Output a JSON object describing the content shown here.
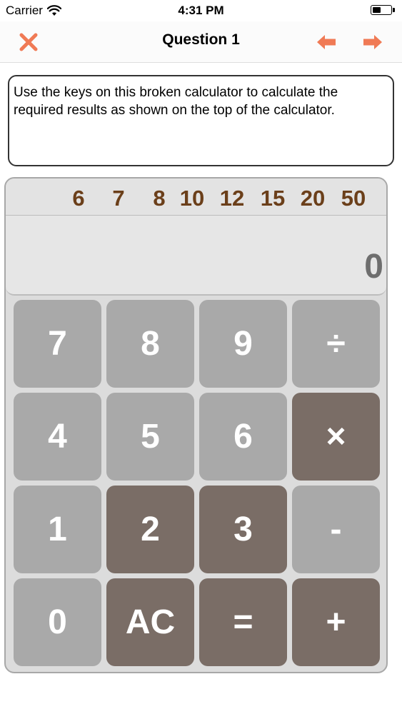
{
  "status_bar": {
    "carrier": "Carrier",
    "time": "4:31 PM"
  },
  "nav": {
    "title": "Question 1",
    "accent_color": "#f07a55"
  },
  "question": {
    "text": "Use the keys on this broken calculator to calculate the required results as shown on the top of the calculator."
  },
  "calculator": {
    "targets": [
      "6",
      "7",
      "8",
      "10",
      "12",
      "15",
      "20",
      "50"
    ],
    "display": "0",
    "keys": [
      {
        "label": "7",
        "state": "enabled"
      },
      {
        "label": "8",
        "state": "enabled"
      },
      {
        "label": "9",
        "state": "enabled"
      },
      {
        "label": "÷",
        "state": "enabled"
      },
      {
        "label": "4",
        "state": "enabled"
      },
      {
        "label": "5",
        "state": "enabled"
      },
      {
        "label": "6",
        "state": "enabled"
      },
      {
        "label": "×",
        "state": "active"
      },
      {
        "label": "1",
        "state": "enabled"
      },
      {
        "label": "2",
        "state": "active"
      },
      {
        "label": "3",
        "state": "active"
      },
      {
        "label": "-",
        "state": "enabled"
      },
      {
        "label": "0",
        "state": "enabled"
      },
      {
        "label": "AC",
        "state": "active"
      },
      {
        "label": "=",
        "state": "active"
      },
      {
        "label": "+",
        "state": "active"
      }
    ]
  }
}
